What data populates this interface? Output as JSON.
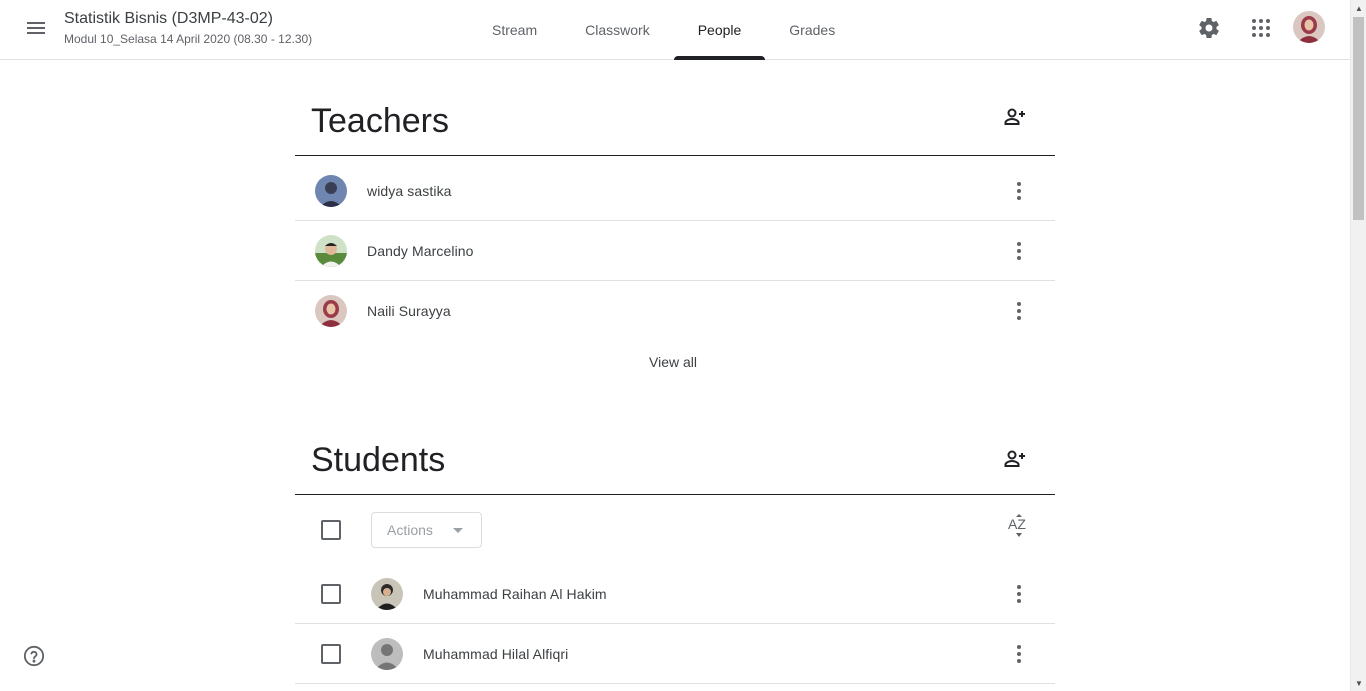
{
  "header": {
    "class_title": "Statistik Bisnis (D3MP-43-02)",
    "class_subtitle": "Modul 10_Selasa 14 April 2020 (08.30 - 12.30)",
    "tabs": [
      {
        "label": "Stream",
        "active": false
      },
      {
        "label": "Classwork",
        "active": false
      },
      {
        "label": "People",
        "active": true
      },
      {
        "label": "Grades",
        "active": false
      }
    ],
    "icons": [
      "menu-icon",
      "gear-icon",
      "apps-grid-icon",
      "account-avatar"
    ]
  },
  "teachers": {
    "title": "Teachers",
    "add_icon": "add-person-icon",
    "people": [
      {
        "name": "widya sastika"
      },
      {
        "name": "Dandy Marcelino"
      },
      {
        "name": "Naili Surayya"
      }
    ],
    "view_all_label": "View all"
  },
  "students": {
    "title": "Students",
    "add_icon": "add-person-icon",
    "actions_label": "Actions",
    "sort_label": "AZ",
    "people": [
      {
        "name": "Muhammad Raihan Al Hakim"
      },
      {
        "name": "Muhammad Hilal Alfiqri"
      }
    ]
  },
  "footer": {
    "help_icon": "help-icon"
  },
  "colors": {
    "text_primary": "#202124",
    "text_secondary": "#5f6368",
    "divider": "#e0e0e0"
  }
}
